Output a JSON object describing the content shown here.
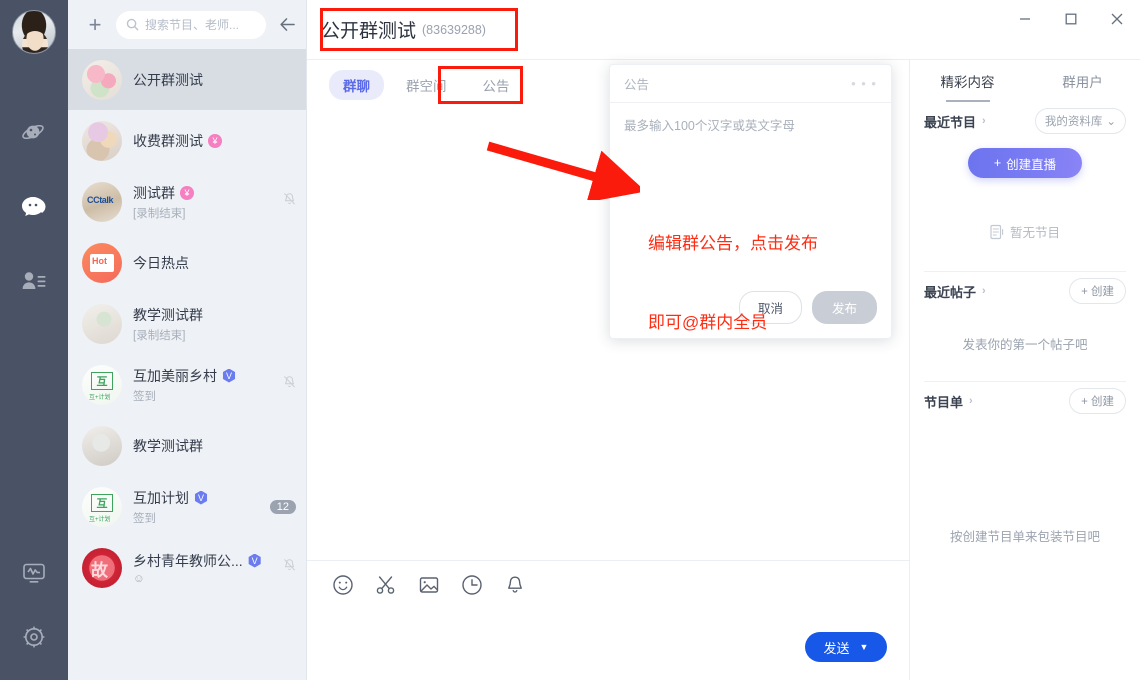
{
  "window": {
    "minimize_label": "—",
    "maximize_label": "▢",
    "close_label": "✕"
  },
  "rail": {
    "avatar_name": "user-avatar",
    "items": [
      {
        "icon": "planet-icon",
        "active": false
      },
      {
        "icon": "chat-bubble-icon",
        "active": true
      },
      {
        "icon": "contacts-icon",
        "active": false
      }
    ],
    "bottom_items": [
      {
        "icon": "monitor-activity-icon"
      },
      {
        "icon": "gear-icon"
      }
    ]
  },
  "chatlist": {
    "add_label": "+",
    "search_placeholder": "搜索节目、老师...",
    "search_value": "",
    "back_label": "←",
    "items": [
      {
        "name": "公开群测试",
        "sub": "",
        "badge": "",
        "verified": false,
        "muted": false,
        "count": "",
        "active": true,
        "avatar": "flowers-pink"
      },
      {
        "name": "收费群测试",
        "sub": "",
        "badge": "¥",
        "verified": false,
        "muted": false,
        "count": "",
        "active": false,
        "avatar": "flowers-bouquet"
      },
      {
        "name": "测试群",
        "sub": "[录制结束]",
        "badge": "¥",
        "verified": false,
        "muted": true,
        "count": "",
        "active": false,
        "avatar": "cctalk"
      },
      {
        "name": "今日热点",
        "sub": "",
        "badge": "",
        "verified": false,
        "muted": false,
        "count": "",
        "active": false,
        "avatar": "hot"
      },
      {
        "name": "教学测试群",
        "sub": "[录制结束]",
        "badge": "",
        "verified": false,
        "muted": false,
        "count": "",
        "active": false,
        "avatar": "room"
      },
      {
        "name": "互加美丽乡村",
        "sub": "签到",
        "badge": "",
        "verified": true,
        "muted": true,
        "count": "",
        "active": false,
        "avatar": "hujia"
      },
      {
        "name": "教学测试群",
        "sub": "",
        "badge": "",
        "verified": false,
        "muted": false,
        "count": "",
        "active": false,
        "avatar": "room2"
      },
      {
        "name": "互加计划",
        "sub": "签到",
        "badge": "",
        "verified": true,
        "muted": false,
        "count": "12",
        "active": false,
        "avatar": "hujia"
      },
      {
        "name": "乡村青年教师公...",
        "sub": "☺",
        "badge": "",
        "verified": true,
        "muted": true,
        "count": "",
        "active": false,
        "avatar": "red-logo"
      }
    ]
  },
  "header": {
    "title": "公开群测试",
    "group_id": "(83639288)"
  },
  "tabs": [
    {
      "label": "群聊",
      "active": true
    },
    {
      "label": "群空间",
      "active": false
    },
    {
      "label": "公告",
      "active": false
    }
  ],
  "announce": {
    "title": "公告",
    "more_label": "• • •",
    "placeholder": "最多输入100个汉字或英文字母",
    "value": "",
    "cancel_label": "取消",
    "publish_label": "发布"
  },
  "composer": {
    "tools": [
      {
        "icon": "emoji-icon"
      },
      {
        "icon": "scissors-icon"
      },
      {
        "icon": "image-icon"
      },
      {
        "icon": "clock-icon"
      },
      {
        "icon": "bell-icon"
      }
    ],
    "send_label": "发送",
    "send_caret": "▼"
  },
  "right_panel": {
    "tabs": [
      {
        "label": "精彩内容",
        "active": true
      },
      {
        "label": "群用户",
        "active": false
      }
    ],
    "sections": [
      {
        "title": "最近节目",
        "chevron": "›",
        "action_label": "我的资料库",
        "action_caret": "⌄",
        "primary_button": "创建直播",
        "primary_button_plus": "+",
        "empty_text": "暂无节目",
        "empty_icon": "document-icon"
      },
      {
        "title": "最近帖子",
        "chevron": "›",
        "action_label": "+ 创建",
        "empty_text": "发表你的第一个帖子吧"
      },
      {
        "title": "节目单",
        "chevron": "›",
        "action_label": "+ 创建",
        "empty_text": "按创建节目单来包装节目吧"
      }
    ]
  },
  "annotations": {
    "red_color": "#fb1b0c",
    "callout_line1": "编辑群公告，点击发布",
    "callout_line2": "即可@群内全员",
    "boxes": [
      {
        "name": "title-highlight-box"
      },
      {
        "name": "announce-tab-highlight-box"
      }
    ]
  }
}
